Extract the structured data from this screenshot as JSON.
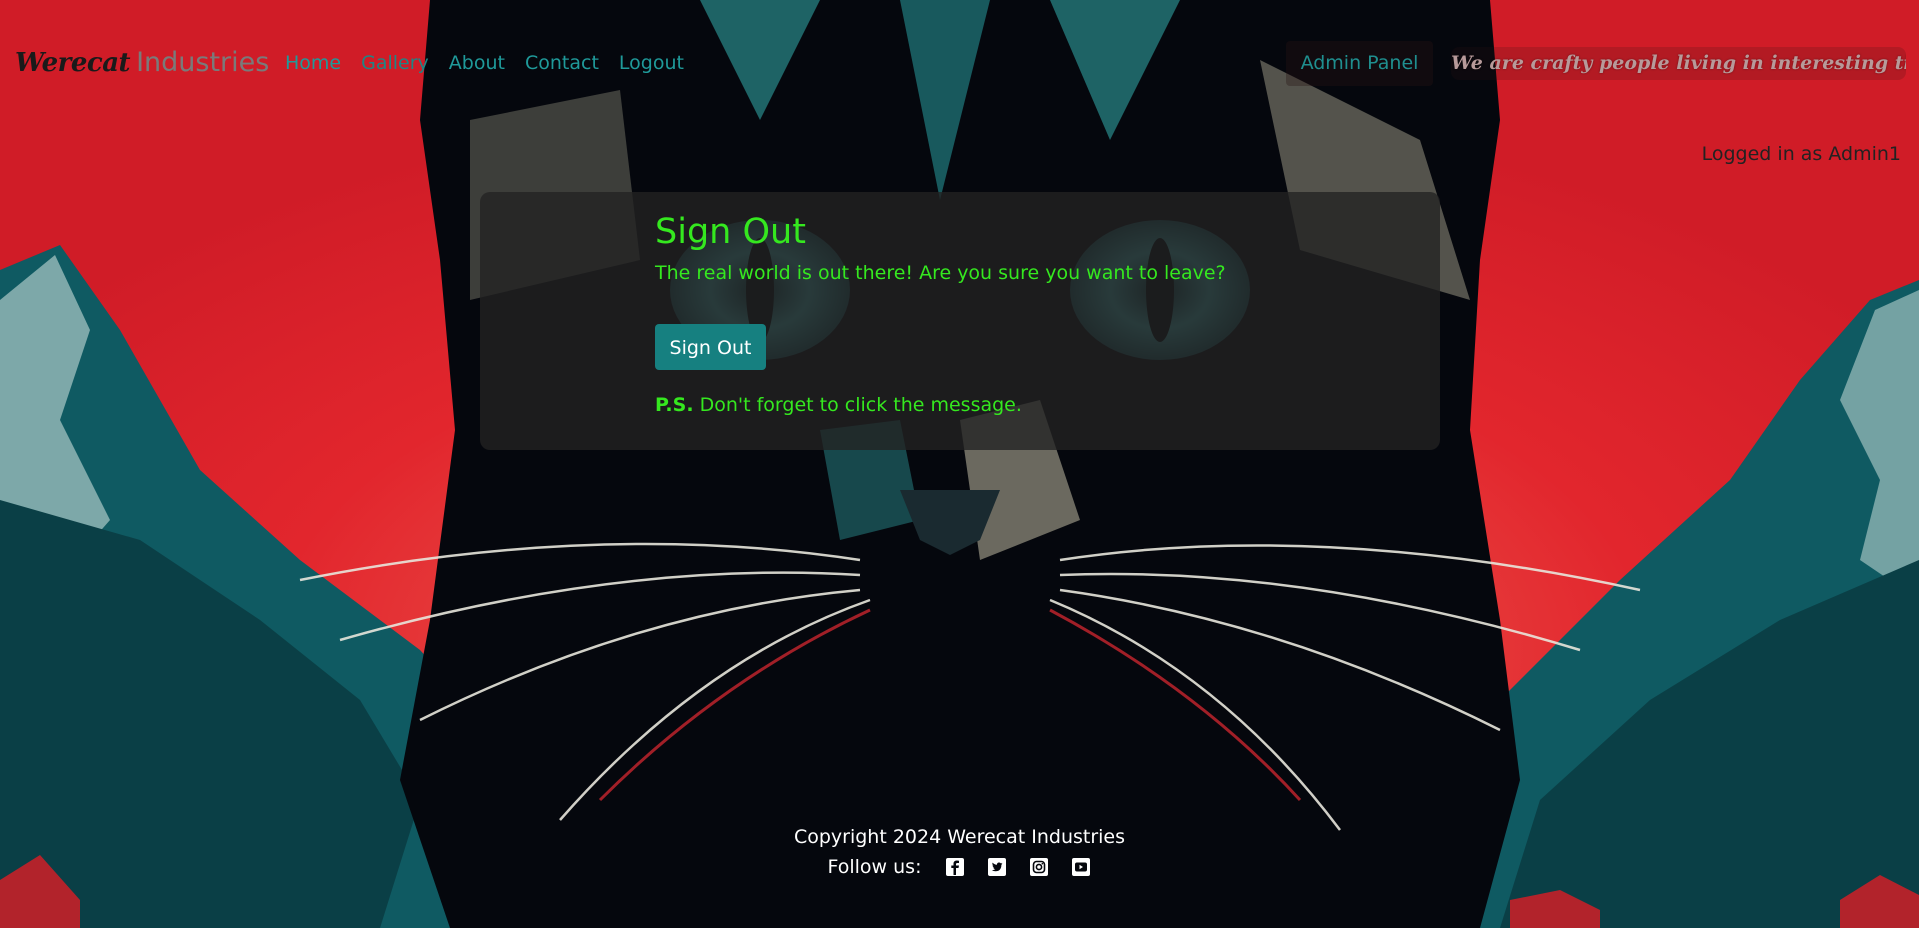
{
  "navbar": {
    "brand_part1": "Werecat",
    "brand_part2": "Industries",
    "links": [
      "Home",
      "Gallery",
      "About",
      "Contact",
      "Logout"
    ],
    "admin_button": "Admin Panel",
    "tagline": "We are crafty people living in interesting times!"
  },
  "user_status": "Logged in as Admin1",
  "card": {
    "title": "Sign Out",
    "message": "The real world is out there! Are you sure you want to leave?",
    "button": "Sign Out",
    "ps_prefix": "P.S.",
    "ps_text": "Don't forget to click the message."
  },
  "footer": {
    "copyright": "Copyright 2024 Werecat Industries",
    "follow_label": "Follow us:",
    "social_icons": [
      "facebook-icon",
      "twitter-icon",
      "instagram-icon",
      "youtube-icon"
    ]
  },
  "colors": {
    "background_red": "#d81e2a",
    "accent_green": "#35e81f",
    "teal": "#168080",
    "nav_link_teal": "#1f9a9a",
    "card_bg": "rgba(35,35,35,0.78)"
  }
}
